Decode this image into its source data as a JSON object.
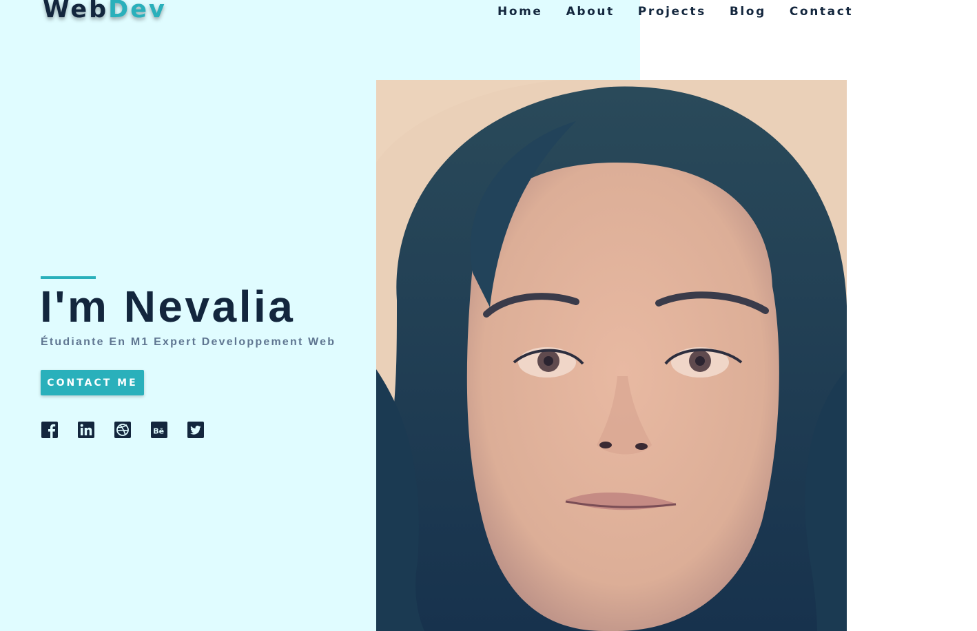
{
  "brand": {
    "name_part1": "Web",
    "name_part2": "Dev",
    "accent_color": "#2ab0bb",
    "dark_color": "#13263d",
    "panel_color": "#e0fcff"
  },
  "nav": {
    "items": [
      {
        "label": "Home"
      },
      {
        "label": "About"
      },
      {
        "label": "Projects"
      },
      {
        "label": "Blog"
      },
      {
        "label": "Contact"
      }
    ]
  },
  "hero": {
    "title": "I'm Nevalia",
    "subtitle": "Étudiante En M1 Expert Developpement Web",
    "cta_label": "CONTACT ME",
    "photo_alt": "Portrait of Nevalia"
  },
  "socials": [
    {
      "icon": "facebook-icon"
    },
    {
      "icon": "linkedin-icon"
    },
    {
      "icon": "dribbble-icon"
    },
    {
      "icon": "behance-icon"
    },
    {
      "icon": "twitter-icon"
    }
  ]
}
